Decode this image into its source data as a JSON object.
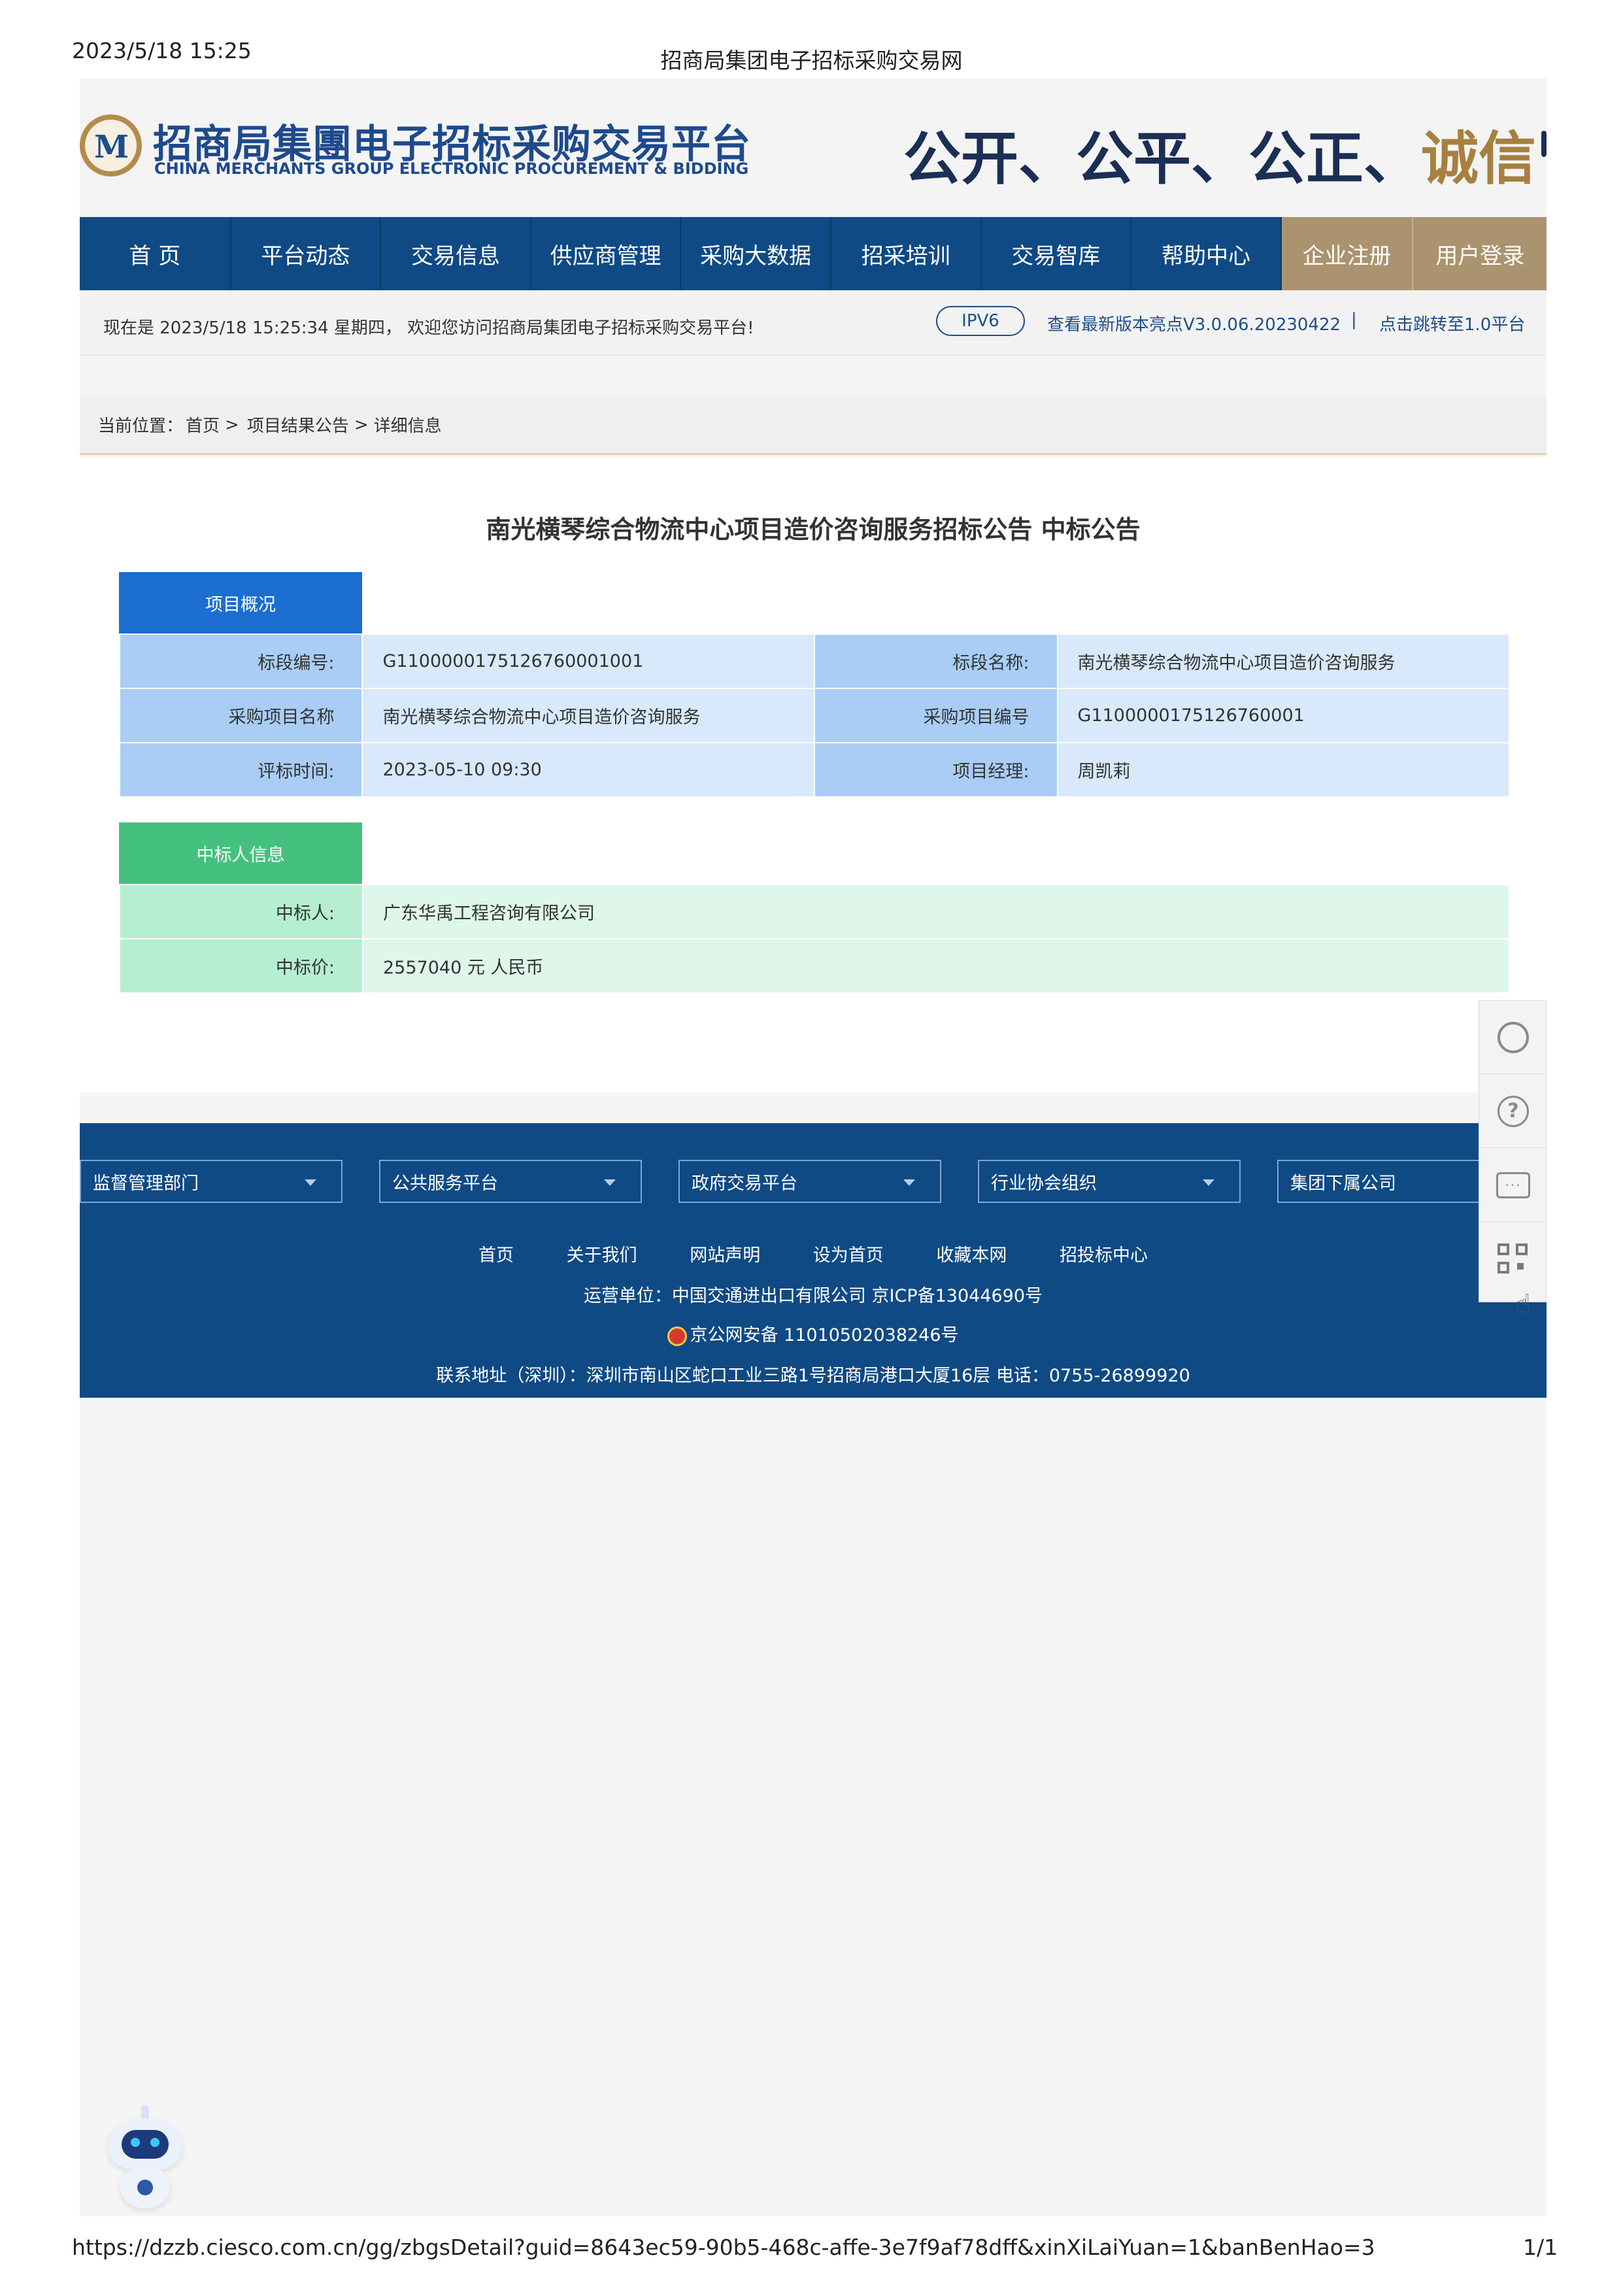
{
  "print_header": {
    "datetime": "2023/5/18 15:25",
    "title": "招商局集团电子招标采购交易网"
  },
  "banner": {
    "logo_mark": "M",
    "logo_cn": "招商局集團电子招标采购交易平台",
    "logo_en": "CHINA MERCHANTS GROUP ELECTRONIC PROCUREMENT & BIDDING",
    "slogan_blue_1": "公开、公平、公正、",
    "slogan_gold": "诚信"
  },
  "nav": {
    "items": [
      "首 页",
      "平台动态",
      "交易信息",
      "供应商管理",
      "采购大数据",
      "招采培训",
      "交易智库",
      "帮助中心"
    ],
    "register": "企业注册",
    "login": "用户登录"
  },
  "infobar": {
    "welcome": "现在是 2023/5/18 15:25:34 星期四， 欢迎您访问招商局集团电子招标采购交易平台!",
    "ipv6": "IPV6",
    "version_link": "查看最新版本亮点V3.0.06.20230422",
    "separator": "|",
    "jump_link": "点击跳转至1.0平台"
  },
  "breadcrumb": {
    "prefix": "当前位置：",
    "items": [
      "首页",
      "项目结果公告",
      "详细信息"
    ],
    "separator": ">"
  },
  "notice": {
    "title": "南光横琴综合物流中心项目造价咨询服务招标公告 中标公告",
    "overview_tab": "项目概况",
    "overview_rows": [
      {
        "l1": "标段编号:",
        "v1": "G1100000175126760001001",
        "l2": "标段名称:",
        "v2": "南光横琴综合物流中心项目造价咨询服务"
      },
      {
        "l1": "采购项目名称",
        "v1": "南光横琴综合物流中心项目造价咨询服务",
        "l2": "采购项目编号",
        "v2": "G1100000175126760001"
      },
      {
        "l1": "评标时间:",
        "v1": "2023-05-10 09:30",
        "l2": "项目经理:",
        "v2": "周凯莉"
      }
    ],
    "winner_tab": "中标人信息",
    "winner_rows": [
      {
        "label": "中标人:",
        "value": "广东华禹工程咨询有限公司"
      },
      {
        "label": "中标价:",
        "value": "2557040 元 人民币"
      }
    ]
  },
  "footer": {
    "dropdowns": [
      "监督管理部门",
      "公共服务平台",
      "政府交易平台",
      "行业协会组织",
      "集团下属公司"
    ],
    "links": [
      "首页",
      "关于我们",
      "网站声明",
      "设为首页",
      "收藏本网",
      "招投标中心"
    ],
    "operator": "运营单位：中国交通进出口有限公司    京ICP备13044690号",
    "police": "京公网安备 11010502038246号",
    "address": "联系地址（深圳）：深圳市南山区蛇口工业三路1号招商局港口大厦16层  电话：0755-26899920"
  },
  "sidebar": {
    "help_glyph": "?",
    "chat_glyph": "···"
  },
  "print_footer": {
    "url": "https://dzzb.ciesco.com.cn/gg/zbgsDetail?guid=8643ec59-90b5-468c-affe-3e7f9af78dff&xinXiLaiYuan=1&banBenHao=3",
    "page": "1/1"
  },
  "colors": {
    "nav_blue": "#0f4a84",
    "nav_gold": "#ab9370",
    "tab_blue": "#1c6ed0",
    "tab_green": "#45c17f"
  }
}
